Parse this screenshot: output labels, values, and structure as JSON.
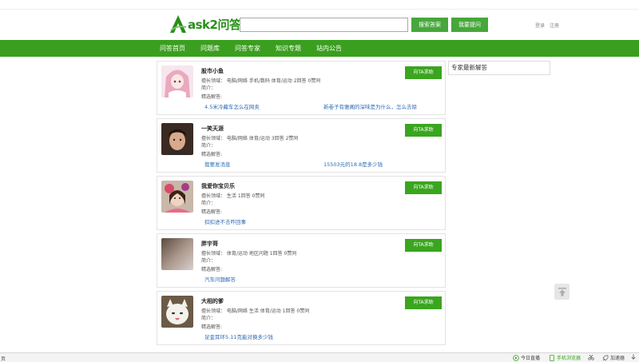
{
  "header": {
    "logo_text": "ask2问答",
    "search_placeholder": "",
    "search_button": "搜索答案",
    "ask_button": "我要提问",
    "login": "登录",
    "register": "注册"
  },
  "nav": {
    "items": [
      "问答首页",
      "问题库",
      "问答专家",
      "知识专题",
      "站内公告"
    ]
  },
  "experts": [
    {
      "name": "股市小鱼",
      "field": "擅长领域： 电脑/网络 手机/数码 体育/运动 2回答 0赞同",
      "intro": "简介：",
      "answers_label": "精选解答:",
      "answers": [
        "4.5米冷藏车怎么在网卖",
        "新卷子有雅阁的深味是为什么，怎么去除"
      ],
      "button": "向TA求助"
    },
    {
      "name": "一笑天涯",
      "field": "擅长领域： 电脑/网络 体育/运动 3回答 2赞同",
      "intro": "简介：",
      "answers_label": "精选解答:",
      "answers": [
        "我要发消息",
        "15503元的18.8是多少钱"
      ],
      "button": "向TA求助"
    },
    {
      "name": "我爱你宝贝乐",
      "field": "擅长领域： 生活 1回答 0赞同",
      "intro": "简介：",
      "answers_label": "精选解答:",
      "answers": [
        "扣扣进不去咋回事"
      ],
      "button": "向TA求助"
    },
    {
      "name": "胖宇哥",
      "field": "擅长领域： 体育/运动 地区问题 1回答 0赞同",
      "intro": "简介：",
      "answers_label": "精选解答:",
      "answers": [
        "汽车问题解答"
      ],
      "button": "向TA求助"
    },
    {
      "name": "大相的爹",
      "field": "擅长领域： 电脑/网络 生活 体育/运动 1回答 0赞同",
      "intro": "简介：",
      "answers_label": "精选解答:",
      "answers": [
        "足金耳环5.11克能对换多少钱"
      ],
      "button": "向TA求助"
    }
  ],
  "sidebar": {
    "latest_title": "专家最新解答"
  },
  "statusbar": {
    "left": "页",
    "today": "今日直播",
    "mobile": "手机浏览器",
    "accelerator": "加速器"
  }
}
